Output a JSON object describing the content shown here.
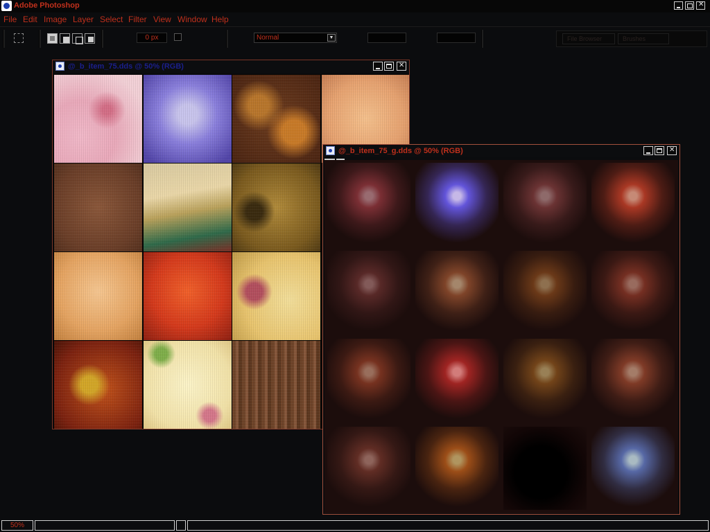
{
  "app": {
    "title": "Adobe Photoshop"
  },
  "menu": {
    "items": [
      "File",
      "Edit",
      "Image",
      "Layer",
      "Select",
      "Filter",
      "View",
      "Window",
      "Help"
    ]
  },
  "options": {
    "feather_value": "0 px",
    "style_value": "Normal",
    "palette_tabs": [
      "File Browser",
      "Brushes"
    ]
  },
  "doc1": {
    "title": "@_b_item_75.dds @ 50% (RGB)",
    "channel_label": "01",
    "tiles": [
      "pink",
      "lavender",
      "floral-brown",
      "peach",
      "brown",
      "watercolor",
      "gold-floral",
      "orange-paper",
      "red",
      "roses",
      "autumn",
      "cream-floral",
      "wood"
    ]
  },
  "doc2": {
    "title": "@_b_item_75_g.dds @ 50% (RGB)",
    "channel_label": "01",
    "glows": [
      [
        "#c84a55",
        0.55
      ],
      [
        "#6a5cf0",
        0.9
      ],
      [
        "#b8585a",
        0.5
      ],
      [
        "#d8462c",
        0.75
      ],
      [
        "#a04a48",
        0.45
      ],
      [
        "#c0683c",
        0.6
      ],
      [
        "#b86424",
        0.5
      ],
      [
        "#bc4a34",
        0.55
      ],
      [
        "#c05030",
        0.55
      ],
      [
        "#c02a28",
        0.8
      ],
      [
        "#b87024",
        0.55
      ],
      [
        "#c05838",
        0.6
      ],
      [
        "#a44c3c",
        0.5
      ],
      [
        "#e0701e",
        0.65
      ],
      [
        "#000000",
        0.0
      ],
      [
        "#6a86d8",
        0.75
      ]
    ]
  },
  "status": {
    "zoom": "50%"
  }
}
